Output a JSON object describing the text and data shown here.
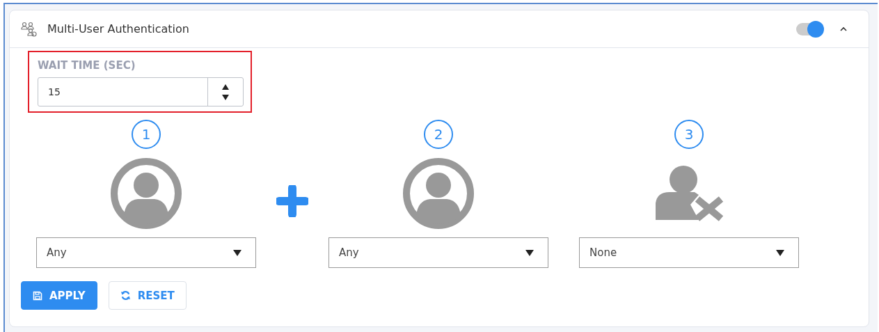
{
  "panel": {
    "title": "Multi-User Authentication",
    "enabled": true,
    "expanded": true
  },
  "wait_time": {
    "label": "WAIT TIME (SEC)",
    "value": "15",
    "highlighted": true
  },
  "steps": [
    {
      "number": "1",
      "kind": "user",
      "selection": "Any"
    },
    {
      "number": "2",
      "kind": "user",
      "selection": "Any",
      "plus_before": true
    },
    {
      "number": "3",
      "kind": "none",
      "selection": "None"
    }
  ],
  "buttons": [
    {
      "label": "APPLY",
      "kind": "primary"
    },
    {
      "label": "RESET",
      "kind": "secondary"
    }
  ]
}
